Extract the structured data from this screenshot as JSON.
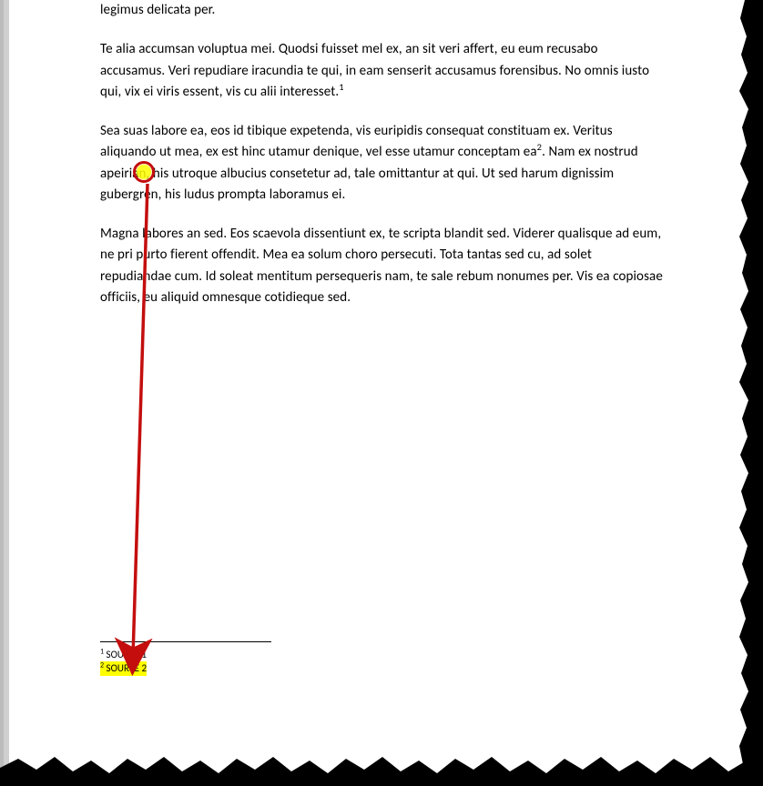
{
  "body": {
    "p0": "legimus delicata per.",
    "p1_a": "Te alia accumsan voluptua mei. Quodsi fuisset mel ex, an sit veri affert, eu eum recusabo accusamus. Veri repudiare iracundia te qui, in eam senserit accusamus forensibus. No omnis iusto qui, vix ei viris essent, vis cu alii interesset.",
    "p1_ref": "1",
    "p2_a": "Sea suas labore ea, eos id tibique expetenda, vis euripidis consequat constituam ex. Veritus aliquando ut mea, ex est hinc utamur denique, vel esse utamur conceptam ea",
    "p2_ref": "2",
    "p2_b": ". Nam ex nostrud apeirian, his utroque albucius consetetur ad, tale omittantur at qui. Ut sed harum dignissim gubergren, his ludus prompta laboramus ei.",
    "p3": "Magna labores an sed. Eos scaevola dissentiunt ex, te scripta blandit sed. Viderer qualisque ad eum, ne pri purto fierent offendit. Mea ea solum choro persecuti. Tota tantas sed cu, ad solet repudiandae cum. Id soleat mentitum persequeris nam, te sale rebum nonumes per. Vis ea copiosae officiis, eu aliquid omnesque cotidieque sed."
  },
  "footnotes": {
    "fn1_mark": "1",
    "fn1_text": " SOURCE 1",
    "fn2_mark": "2",
    "fn2_text": " SOURCE 2"
  },
  "annotation": {
    "circle_target": "footnote-ref-2",
    "arrow_from": "footnote-ref-2",
    "arrow_to": "footnote-2",
    "highlight": "footnote-2",
    "color": "#c40e0e"
  }
}
